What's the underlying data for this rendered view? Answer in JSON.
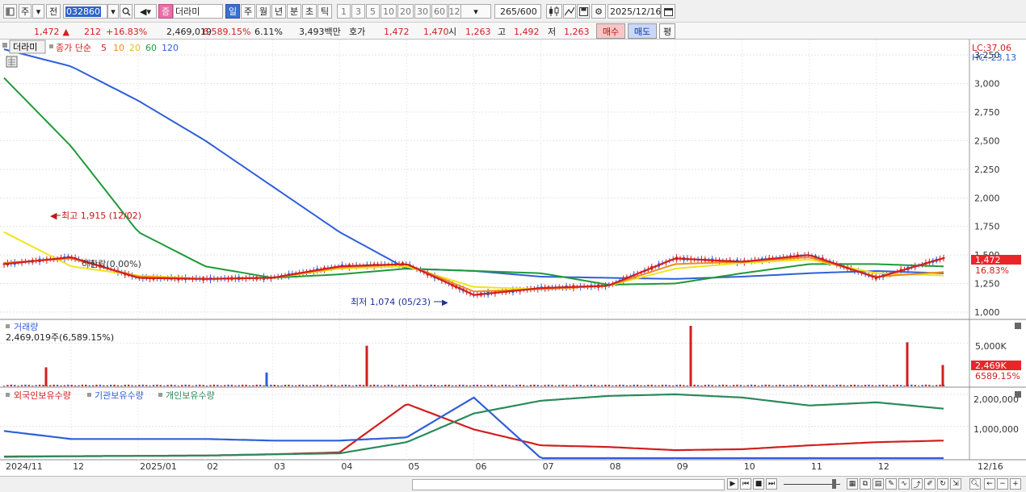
{
  "toolbar": {
    "market_select": "주",
    "market_type": "전",
    "stock_code": "032860",
    "stock_type_badge": "증",
    "stock_name": "더라미",
    "period_tabs": [
      "일",
      "주",
      "월",
      "년",
      "분",
      "초",
      "틱"
    ],
    "active_period": "일",
    "interval_buttons": [
      "1",
      "3",
      "5",
      "10",
      "20",
      "30",
      "60",
      "120"
    ],
    "count_current": "265",
    "count_total": "/600",
    "date": "2025/12/16"
  },
  "quote": {
    "price": "1,472",
    "arrow": "▲",
    "change": "212",
    "change_pct": "+16.83%",
    "volume": "2,469,019",
    "volume_pct": "6,589.15%",
    "turnover": "6.11%",
    "amount": "3,493백만",
    "hoga_label": "호가",
    "hoga_ask": "1,472",
    "hoga_bid": "1,470",
    "open_label": "시",
    "open": "1,263",
    "high_label": "고",
    "high": "1,492",
    "low_label": "저",
    "low": "1,263",
    "buy_label": "매수",
    "sell_label": "매도",
    "avg_label": "평"
  },
  "price_panel": {
    "title": "더라미",
    "legend_prefix": "종가 단순",
    "ma": [
      {
        "period": "5",
        "color": "#d21f1f"
      },
      {
        "period": "10",
        "color": "#f08a1c"
      },
      {
        "period": "20",
        "color": "#f0e41c"
      },
      {
        "period": "60",
        "color": "#1f9a3a"
      },
      {
        "period": "120",
        "color": "#2f5fd9"
      }
    ],
    "lc": "LC:37.06",
    "hc": "HC:-23.13",
    "y_ticks": [
      "3,250",
      "3,000",
      "2,750",
      "2,500",
      "2,250",
      "2,000",
      "1,750",
      "1,500",
      "1,250",
      "1,000"
    ],
    "last_price_tag": "1,472",
    "last_pct_tag": "16.83%",
    "ann_high": "최고 1,915 (12/02)",
    "ann_low": "최저 1,074 (05/23)",
    "ann_limitdown": "하한락(0.00%)"
  },
  "volume_panel": {
    "title": "거래량",
    "subtitle": "2,469,019주(6,589.15%)",
    "y_tick": "5,000K",
    "last_tag": "2,469K",
    "last_pct": "6589.15%"
  },
  "holdings_panel": {
    "legend": [
      {
        "label": "외국인보유수량",
        "color": "#d21f1f"
      },
      {
        "label": "기관보유수량",
        "color": "#2f5fd9"
      },
      {
        "label": "개인보유수량",
        "color": "#2a8a5a"
      }
    ],
    "y_ticks": [
      "2,000,000",
      "1,000,000"
    ]
  },
  "x_axis": {
    "labels": [
      "2024/11",
      "12",
      "2025/01",
      "02",
      "03",
      "04",
      "05",
      "06",
      "07",
      "08",
      "09",
      "10",
      "11",
      "12"
    ],
    "last_date": "12/16"
  },
  "chart_data": [
    {
      "type": "line",
      "title": "더라미",
      "xlabel": "",
      "ylabel": "",
      "ylim": [
        950,
        3350
      ],
      "x": [
        "2024/11",
        "12",
        "2025/01",
        "02",
        "03",
        "04",
        "05",
        "06",
        "07",
        "08",
        "09",
        "10",
        "11",
        "12",
        "12/16"
      ],
      "series": [
        {
          "name": "5",
          "values": [
            1420,
            1480,
            1300,
            1290,
            1300,
            1400,
            1420,
            1150,
            1210,
            1230,
            1470,
            1440,
            1500,
            1300,
            1472
          ]
        },
        {
          "name": "10",
          "values": [
            1430,
            1470,
            1310,
            1290,
            1300,
            1390,
            1420,
            1180,
            1200,
            1230,
            1420,
            1440,
            1480,
            1310,
            1350
          ]
        },
        {
          "name": "20",
          "values": [
            1700,
            1400,
            1320,
            1290,
            1300,
            1380,
            1400,
            1220,
            1200,
            1230,
            1380,
            1430,
            1460,
            1340,
            1320
          ]
        },
        {
          "name": "60",
          "values": [
            3050,
            2450,
            1700,
            1400,
            1300,
            1330,
            1380,
            1360,
            1340,
            1240,
            1250,
            1340,
            1420,
            1420,
            1400
          ]
        },
        {
          "name": "120",
          "values": [
            3300,
            3150,
            2850,
            2500,
            2100,
            1700,
            1380,
            1360,
            1310,
            1300,
            1290,
            1310,
            1340,
            1360,
            1340
          ]
        }
      ],
      "annotations": [
        "최고 1,915 (12/02)",
        "최저 1,074 (05/23)",
        "하한락(0.00%)"
      ]
    },
    {
      "type": "bar",
      "title": "거래량",
      "ylim": [
        0,
        7000
      ],
      "unit": "K",
      "peaks": [
        {
          "x": "2024/12/02",
          "value": 2200
        },
        {
          "x": "2025/03",
          "value": 1600
        },
        {
          "x": "2025/04",
          "value": 4700
        },
        {
          "x": "2025/09",
          "value": 7000
        },
        {
          "x": "2025/12",
          "value": 5100
        },
        {
          "x": "12/16",
          "value": 2469
        }
      ]
    },
    {
      "type": "line",
      "ylim": [
        0,
        2200000
      ],
      "x": [
        "2024/11",
        "12",
        "2025/01",
        "02",
        "03",
        "04",
        "05",
        "06",
        "07",
        "08",
        "09",
        "10",
        "11",
        "12",
        "12/16"
      ],
      "series": [
        {
          "name": "외국인보유수량",
          "values": [
            50000,
            60000,
            70000,
            80000,
            120000,
            180000,
            1700000,
            900000,
            400000,
            350000,
            250000,
            280000,
            400000,
            500000,
            550000
          ]
        },
        {
          "name": "기관보유수량",
          "values": [
            850000,
            600000,
            600000,
            600000,
            550000,
            550000,
            650000,
            1900000,
            0,
            0,
            0,
            0,
            0,
            0,
            0
          ]
        },
        {
          "name": "개인보유수량",
          "values": [
            40000,
            60000,
            70000,
            80000,
            120000,
            150000,
            500000,
            1400000,
            1800000,
            1950000,
            2000000,
            1900000,
            1650000,
            1750000,
            1550000
          ]
        }
      ]
    }
  ]
}
